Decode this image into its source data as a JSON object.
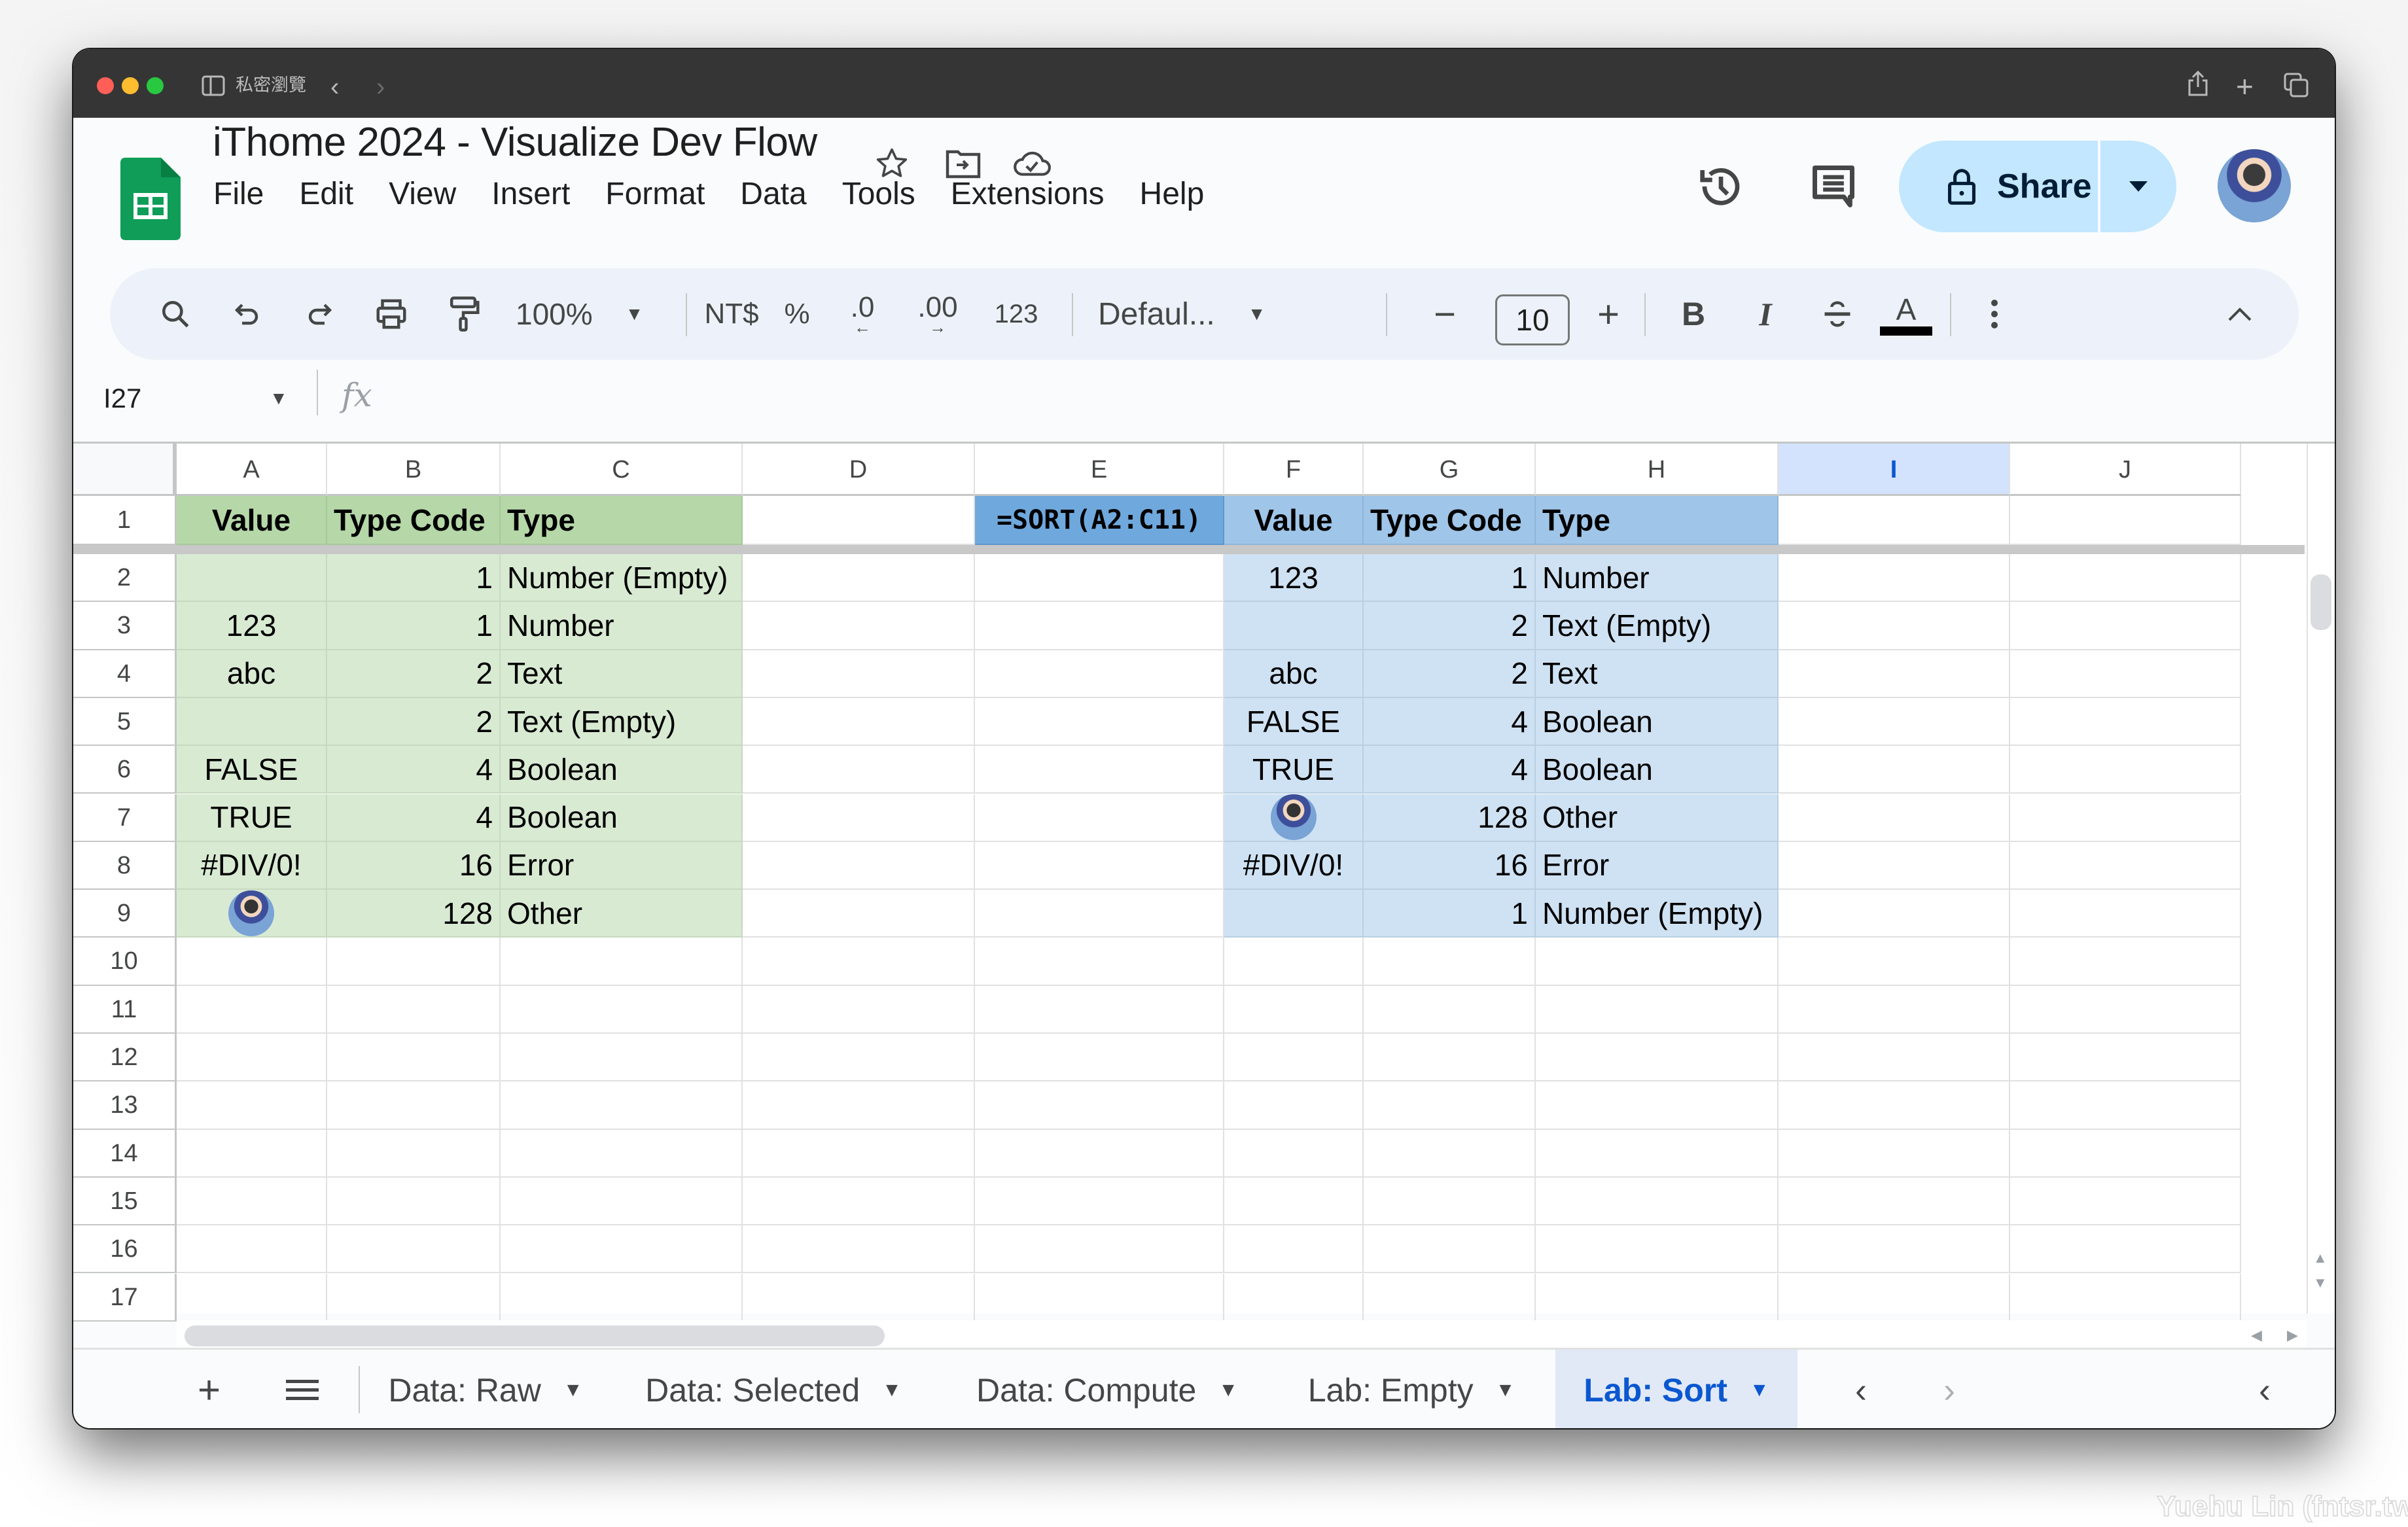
{
  "browser": {
    "mode_label": "私密瀏覽"
  },
  "header": {
    "title": "iThome 2024 - Visualize Dev Flow",
    "menu": [
      "File",
      "Edit",
      "View",
      "Insert",
      "Format",
      "Data",
      "Tools",
      "Extensions",
      "Help"
    ],
    "share_label": "Share"
  },
  "toolbar": {
    "zoom": "100%",
    "currency": "NT$",
    "percent": "%",
    "decrease_decimal": ".0",
    "increase_decimal": ".00",
    "number_format": "123",
    "font": "Defaul...",
    "font_size": "10",
    "bold": "B",
    "italic": "I",
    "text_color": "A"
  },
  "formula_bar": {
    "cell_ref": "I27",
    "fx": "fx",
    "value": ""
  },
  "grid": {
    "columns": [
      "A",
      "B",
      "C",
      "D",
      "E",
      "F",
      "G",
      "H",
      "I",
      "J"
    ],
    "selected_column": "I",
    "rows": [
      "1",
      "2",
      "3",
      "4",
      "5",
      "6",
      "7",
      "8",
      "9",
      "10",
      "11",
      "12",
      "13",
      "14",
      "15",
      "16",
      "17"
    ],
    "source_header": [
      "Value",
      "Type Code",
      "Type"
    ],
    "source_rows": [
      [
        "",
        "1",
        "Number (Empty)"
      ],
      [
        "123",
        "1",
        "Number"
      ],
      [
        "abc",
        "2",
        "Text"
      ],
      [
        "",
        "2",
        "Text (Empty)"
      ],
      [
        "FALSE",
        "4",
        "Boolean"
      ],
      [
        "TRUE",
        "4",
        "Boolean"
      ],
      [
        "#DIV/0!",
        "16",
        "Error"
      ],
      [
        "[image]",
        "128",
        "Other"
      ]
    ],
    "formula_cell": "=SORT(A2:C11)",
    "sorted_header": [
      "Value",
      "Type Code",
      "Type"
    ],
    "sorted_rows": [
      [
        "123",
        "1",
        "Number"
      ],
      [
        "",
        "2",
        "Text (Empty)"
      ],
      [
        "abc",
        "2",
        "Text"
      ],
      [
        "FALSE",
        "4",
        "Boolean"
      ],
      [
        "TRUE",
        "4",
        "Boolean"
      ],
      [
        "[image]",
        "128",
        "Other"
      ],
      [
        "#DIV/0!",
        "16",
        "Error"
      ],
      [
        "",
        "1",
        "Number (Empty)"
      ]
    ]
  },
  "sheets": {
    "tabs": [
      "Data: Raw",
      "Data: Selected",
      "Data: Compute",
      "Lab: Empty",
      "Lab: Sort"
    ],
    "active": "Lab: Sort"
  },
  "colors": {
    "source_header": "#b6d7a8",
    "source_body": "#d9ead3",
    "sorted_header": "#9fc5e8",
    "formula_cell": "#6fa8dc",
    "sorted_body": "#cfe2f3",
    "accent": "#0b57d0",
    "share_bg": "#c2e7ff"
  },
  "watermark": "Yuehu Lin (fntsr.tw)"
}
